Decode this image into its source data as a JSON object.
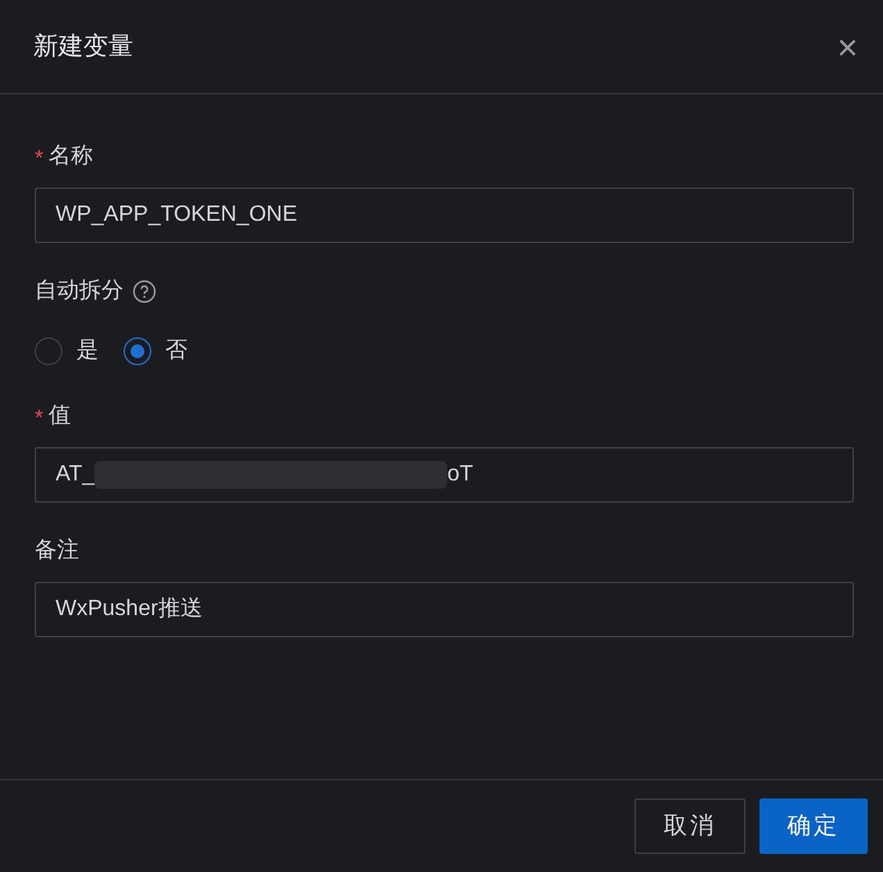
{
  "dialog": {
    "title": "新建变量",
    "close": "×"
  },
  "fields": [
    {
      "kind": "text",
      "label": "名称",
      "required_mark": "*",
      "value": "WP_APP_TOKEN_ONE"
    },
    {
      "kind": "radio",
      "label": "自动拆分",
      "help": true,
      "options": [
        {
          "label": "是",
          "selected": false
        },
        {
          "label": "否",
          "selected": true
        }
      ]
    },
    {
      "kind": "redacted",
      "label": "值",
      "required_mark": "*",
      "value_start": "AT_",
      "value_end": "oT"
    },
    {
      "kind": "text",
      "label": "备注",
      "value": "WxPusher推送"
    }
  ],
  "buttons": [
    {
      "label": "取消",
      "kind": "secondary"
    },
    {
      "label": "确定",
      "kind": "primary"
    }
  ]
}
